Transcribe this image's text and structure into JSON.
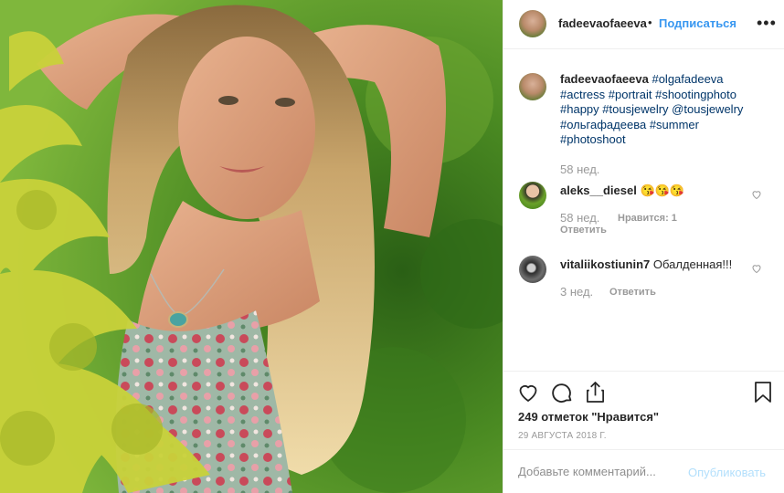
{
  "post": {
    "author": "fadeevaofaeeva",
    "separator": "•",
    "follow_label": "Подписаться",
    "more_icon": "more-horizontal-icon",
    "caption": {
      "author": "fadeevaofaeeva",
      "tags": [
        "#olgafadeeva",
        "#actress",
        "#portrait",
        "#shootingphoto",
        "#happy",
        "#tousjewelry",
        "@tousjewelry",
        "#ольгафадеева",
        "#summer",
        "#photoshoot"
      ],
      "age": "58 нед."
    },
    "comments": [
      {
        "user": "aleks__diesel",
        "text": "😘😘😘",
        "age": "58 нед.",
        "likes": "Нравится: 1",
        "reply": "Ответить"
      },
      {
        "user": "vitaliikostiunin7",
        "text": "Обалденная!!!",
        "age": "3 нед.",
        "reply": "Ответить"
      }
    ],
    "likes": "249 отметок \"Нравится\"",
    "date": "29 АВГУСТА 2018 Г.",
    "comment_placeholder": "Добавьте комментарий...",
    "publish_label": "Опубликовать"
  },
  "icons": {
    "like": "heart-icon",
    "comment": "comment-icon",
    "share": "share-icon",
    "save": "bookmark-icon"
  },
  "colors": {
    "link": "#3897f0",
    "hashtag": "#003569",
    "muted": "#999999",
    "publish_disabled": "#b2dffc"
  }
}
